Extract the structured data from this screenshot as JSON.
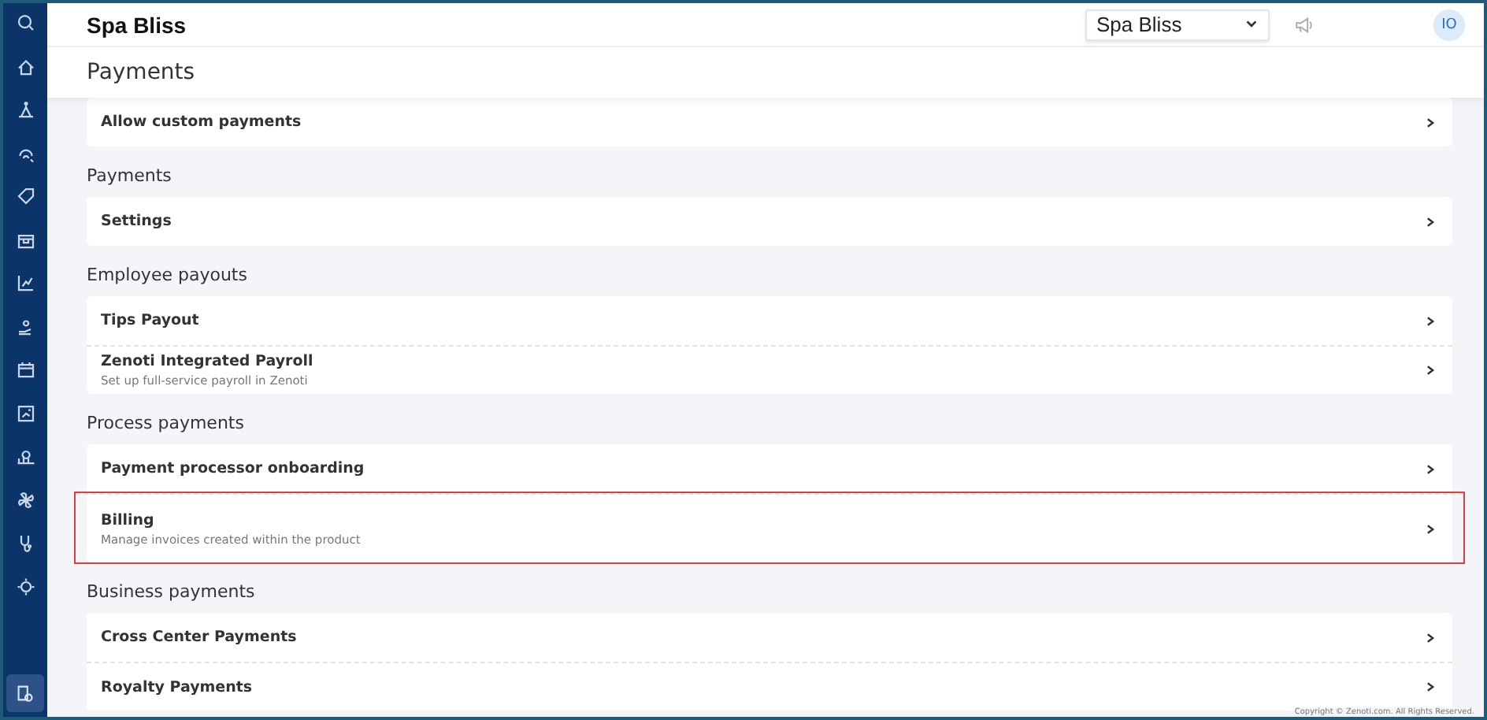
{
  "sidebar": {
    "items": [
      {
        "selected": false
      },
      {
        "selected": false
      },
      {
        "selected": false
      },
      {
        "selected": false
      },
      {
        "selected": false
      },
      {
        "selected": false
      },
      {
        "selected": false
      },
      {
        "selected": false
      },
      {
        "selected": false
      },
      {
        "selected": false
      },
      {
        "selected": false
      },
      {
        "selected": false
      },
      {
        "selected": false
      }
    ],
    "bottom_item": {
      "selected": true
    }
  },
  "header": {
    "brand": "Spa Bliss",
    "center_select": {
      "value": "Spa Bliss"
    },
    "avatar": "IO"
  },
  "page_title": "Payments",
  "sections": [
    {
      "rows": [
        {
          "title": "Allow custom payments",
          "highlighted": false
        }
      ]
    },
    {
      "title": "Payments",
      "rows": [
        {
          "title": "Settings",
          "highlighted": false
        }
      ]
    },
    {
      "title": "Employee payouts",
      "rows": [
        {
          "title": "Tips Payout",
          "highlighted": false
        },
        {
          "title": "Zenoti Integrated Payroll",
          "subtitle": "Set up full-service payroll in Zenoti",
          "highlighted": false
        }
      ]
    },
    {
      "title": "Process payments",
      "rows": [
        {
          "title": "Payment processor onboarding",
          "highlighted": false
        },
        {
          "title": "Billing",
          "subtitle": "Manage invoices created within the product",
          "highlighted": true
        }
      ]
    },
    {
      "title": "Business payments",
      "rows": [
        {
          "title": "Cross Center Payments",
          "highlighted": false
        },
        {
          "title": "Royalty Payments",
          "highlighted": false
        }
      ]
    }
  ],
  "footer": "Copyright © Zenoti.com. All Rights Reserved."
}
